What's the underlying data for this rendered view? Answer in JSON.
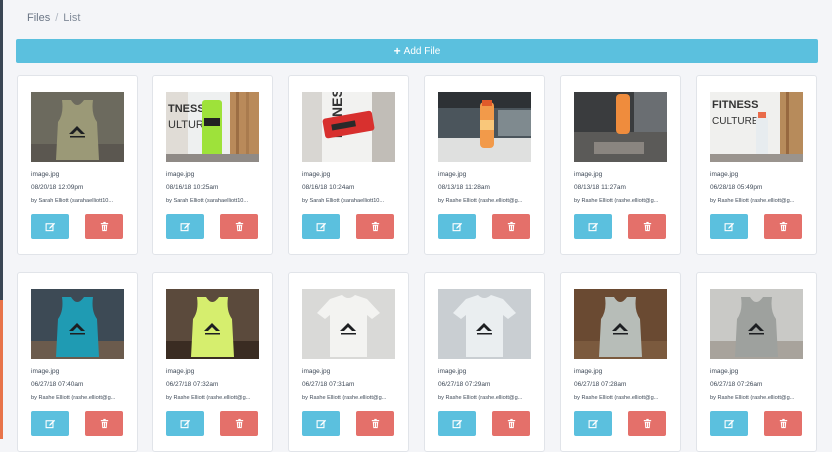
{
  "breadcrumb": {
    "items": [
      "Files",
      "List"
    ],
    "separator": "/"
  },
  "toolbar": {
    "add_label": "Add File",
    "add_icon": "plus-icon"
  },
  "colors": {
    "primary": "#5bc0de",
    "danger": "#e4706a"
  },
  "files": [
    {
      "name": "image.jpg",
      "date": "08/20/18 12:09pm",
      "by": "by Sarah Elliott (sarahaelliott10...",
      "thumb": "olive-tank"
    },
    {
      "name": "image.jpg",
      "date": "08/16/18 10:25am",
      "by": "by Sarah Elliott (sarahaelliott10...",
      "thumb": "green-can"
    },
    {
      "name": "image.jpg",
      "date": "08/16/18 10:24am",
      "by": "by Sarah Elliott (sarahaelliott10...",
      "thumb": "red-can"
    },
    {
      "name": "image.jpg",
      "date": "08/13/18 11:28am",
      "by": "by Rashe Elliott (rashe.elliott@g...",
      "thumb": "orange-bottle-counter"
    },
    {
      "name": "image.jpg",
      "date": "08/13/18 11:27am",
      "by": "by Rashe Elliott (rashe.elliott@g...",
      "thumb": "orange-bottle-window"
    },
    {
      "name": "image.jpg",
      "date": "06/28/18 05:49pm",
      "by": "by Rashe Elliott (rashe.elliott@g...",
      "thumb": "white-bottle"
    },
    {
      "name": "image.jpg",
      "date": "06/27/18 07:40am",
      "by": "by Rashe Elliott (rashe.elliott@g...",
      "thumb": "teal-tank"
    },
    {
      "name": "image.jpg",
      "date": "06/27/18 07:32am",
      "by": "by Rashe Elliott (rashe.elliott@g...",
      "thumb": "lime-tank"
    },
    {
      "name": "image.jpg",
      "date": "06/27/18 07:31am",
      "by": "by Rashe Elliott (rashe.elliott@g...",
      "thumb": "white-tee"
    },
    {
      "name": "image.jpg",
      "date": "06/27/18 07:29am",
      "by": "by Rashe Elliott (rashe.elliott@g...",
      "thumb": "light-tee"
    },
    {
      "name": "image.jpg",
      "date": "06/27/18 07:28am",
      "by": "by Rashe Elliott (rashe.elliott@g...",
      "thumb": "grey-tank-wood"
    },
    {
      "name": "image.jpg",
      "date": "06/27/18 07:26am",
      "by": "by Rashe Elliott (rashe.elliott@g...",
      "thumb": "grey-tank-wall"
    }
  ]
}
